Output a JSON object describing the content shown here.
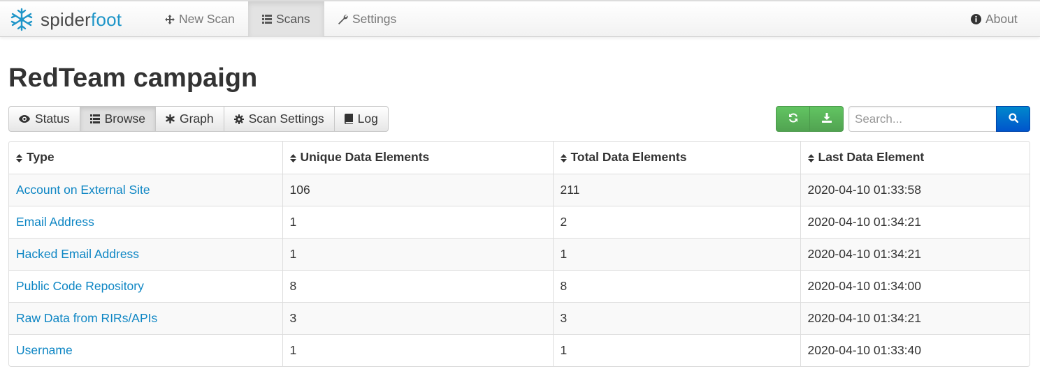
{
  "app": {
    "brand_part1": "spider",
    "brand_part2": "foot",
    "accent_color": "#1e95c8"
  },
  "nav": {
    "new_scan": "New Scan",
    "scans": "Scans",
    "settings": "Settings",
    "about": "About"
  },
  "page": {
    "title": "RedTeam campaign"
  },
  "tabs": [
    {
      "label": "Status",
      "icon": "eye-icon"
    },
    {
      "label": "Browse",
      "icon": "list-icon",
      "active": true
    },
    {
      "label": "Graph",
      "icon": "asterisk-icon"
    },
    {
      "label": "Scan Settings",
      "icon": "gear-icon"
    },
    {
      "label": "Log",
      "icon": "book-icon"
    }
  ],
  "toolbar": {
    "refresh_icon": "refresh-icon",
    "download_icon": "download-icon",
    "search_placeholder": "Search...",
    "search_icon": "search-icon"
  },
  "table": {
    "columns": [
      "Type",
      "Unique Data Elements",
      "Total Data Elements",
      "Last Data Element"
    ],
    "rows": [
      {
        "type": "Account on External Site",
        "unique": "106",
        "total": "211",
        "last": "2020-04-10 01:33:58"
      },
      {
        "type": "Email Address",
        "unique": "1",
        "total": "2",
        "last": "2020-04-10 01:34:21"
      },
      {
        "type": "Hacked Email Address",
        "unique": "1",
        "total": "1",
        "last": "2020-04-10 01:34:21"
      },
      {
        "type": "Public Code Repository",
        "unique": "8",
        "total": "8",
        "last": "2020-04-10 01:34:00"
      },
      {
        "type": "Raw Data from RIRs/APIs",
        "unique": "3",
        "total": "3",
        "last": "2020-04-10 01:34:21"
      },
      {
        "type": "Username",
        "unique": "1",
        "total": "1",
        "last": "2020-04-10 01:33:40"
      }
    ]
  }
}
